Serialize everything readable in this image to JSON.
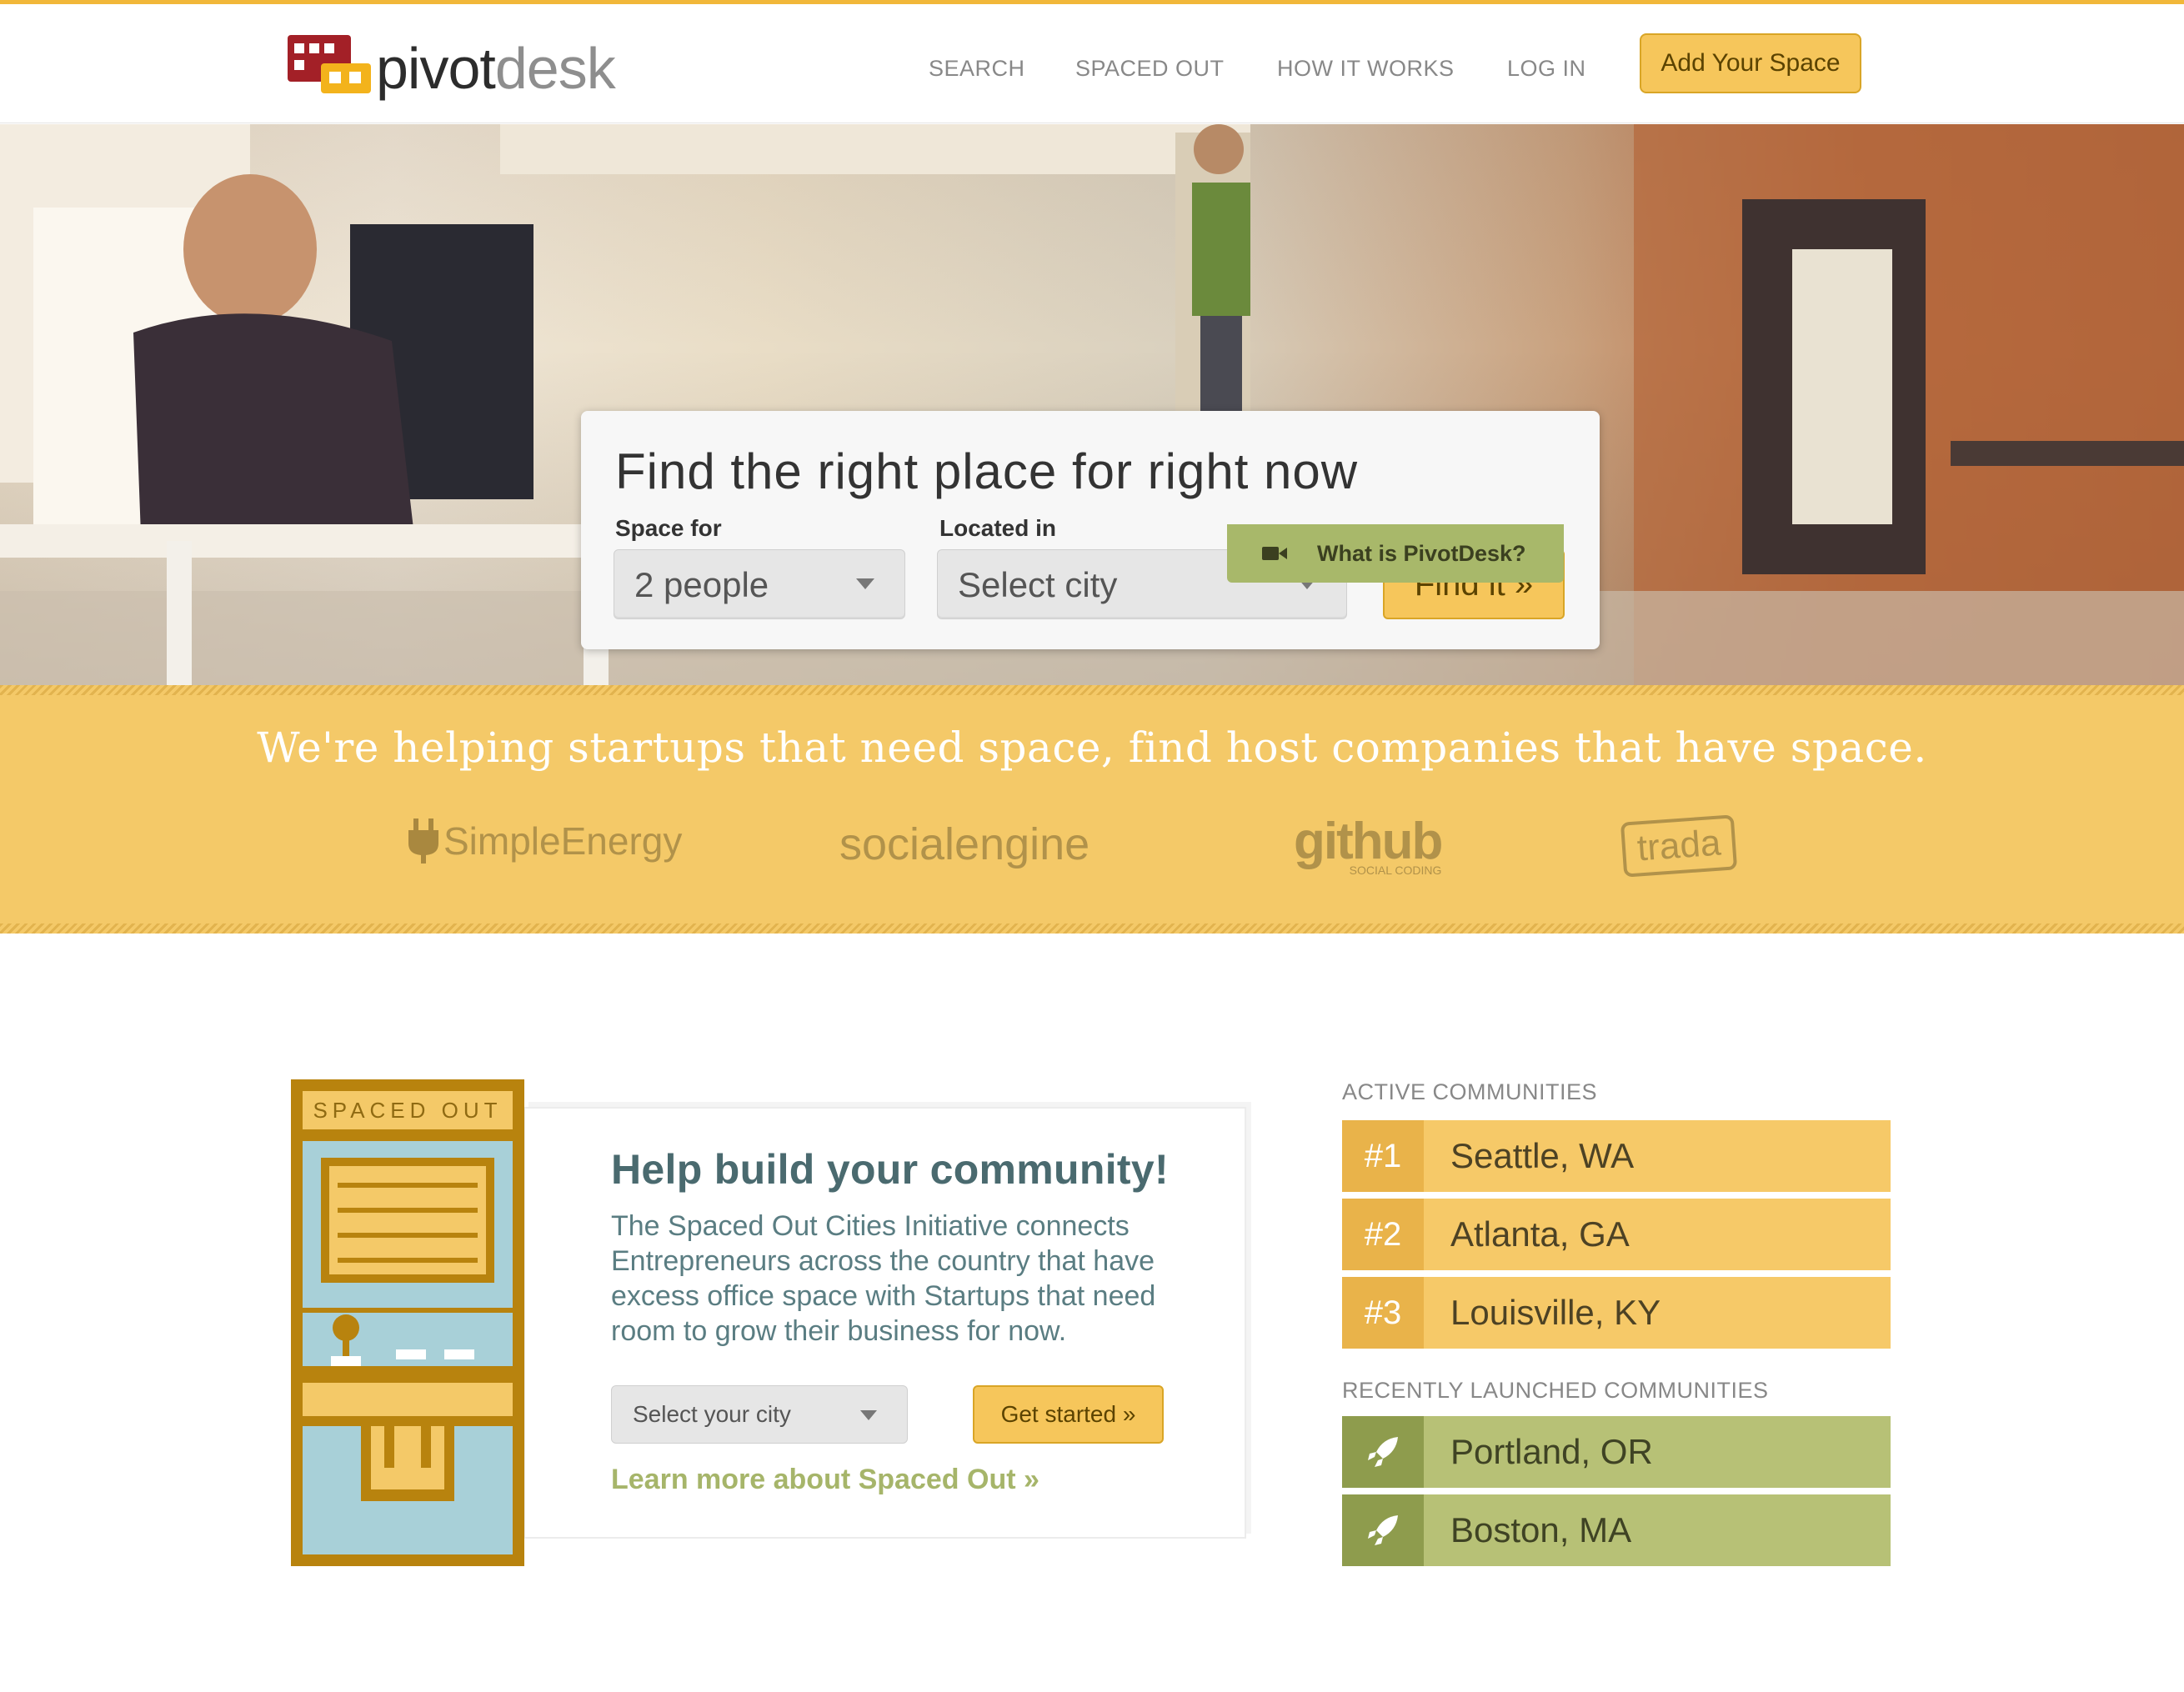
{
  "brand": {
    "name_first": "pivot",
    "name_second": "desk",
    "accent": "#f6c65b",
    "logo_red": "#a32027",
    "logo_yellow": "#f3b31c"
  },
  "nav": {
    "items": [
      {
        "label": "SEARCH"
      },
      {
        "label": "SPACED OUT"
      },
      {
        "label": "HOW IT WORKS"
      },
      {
        "label": "LOG IN"
      }
    ],
    "cta": "Add Your Space"
  },
  "hero": {
    "title": "Find the right place for right now",
    "space_for_label": "Space for",
    "space_for_value": "2 people",
    "located_in_label": "Located in",
    "located_in_value": "Select city",
    "find_button": "Find it »",
    "what_is": "What is PivotDesk?",
    "icons": {
      "video": "video-camera-icon"
    }
  },
  "band": {
    "tagline": "We're helping startups that need space, find host companies that have space.",
    "logos": [
      {
        "name": "SimpleEnergy"
      },
      {
        "name": "socialengine"
      },
      {
        "name": "github",
        "sub": "SOCIAL CODING"
      },
      {
        "name": "trada"
      }
    ]
  },
  "spaced_out": {
    "badge": "SPACED OUT",
    "title": "Help build your community!",
    "text": "The Spaced Out Cities Initiative connects Entrepreneurs across the country that have excess office space with Startups that need room to grow their business for now.",
    "select_value": "Select your city",
    "get_started": "Get started »",
    "learn_more": "Learn more about Spaced Out »"
  },
  "communities": {
    "active_header": "ACTIVE COMMUNITIES",
    "active": [
      {
        "rank": "#1",
        "city": "Seattle, WA"
      },
      {
        "rank": "#2",
        "city": "Atlanta, GA"
      },
      {
        "rank": "#3",
        "city": "Louisville, KY"
      }
    ],
    "recent_header": "RECENTLY LAUNCHED COMMUNITIES",
    "recent": [
      {
        "city": "Portland, OR",
        "icon": "rocket-icon"
      },
      {
        "city": "Boston, MA",
        "icon": "rocket-icon"
      }
    ]
  }
}
